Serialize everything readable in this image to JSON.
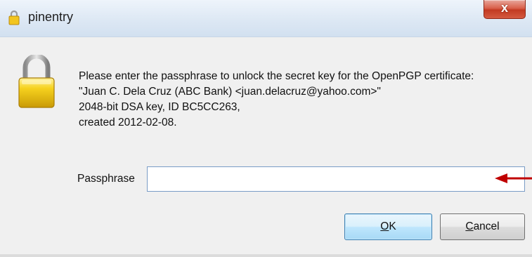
{
  "window": {
    "title": "pinentry",
    "close_symbol": "x",
    "title_icon": "lock-icon"
  },
  "dialog": {
    "icon": "padlock-icon",
    "message_lines": [
      "Please enter the passphrase to unlock the secret key for the OpenPGP certificate:",
      "\"Juan C. Dela Cruz (ABC Bank) <juan.delacruz@yahoo.com>\"",
      "2048-bit DSA key, ID BC5CC263,",
      "created 2012-02-08."
    ],
    "passphrase": {
      "label": "Passphrase",
      "value": ""
    },
    "annotation": {
      "icon": "red-arrow-icon",
      "color": "#c00000"
    },
    "buttons": {
      "ok": {
        "label": "OK",
        "mnemonic": "O",
        "rest": "K"
      },
      "cancel": {
        "label": "Cancel",
        "mnemonic": "C",
        "rest": "ancel"
      }
    }
  },
  "colors": {
    "titlebar": "#dde8f4",
    "close_button": "#c23a22",
    "ok_border": "#3c7fb1",
    "input_border": "#7a9cc6"
  }
}
